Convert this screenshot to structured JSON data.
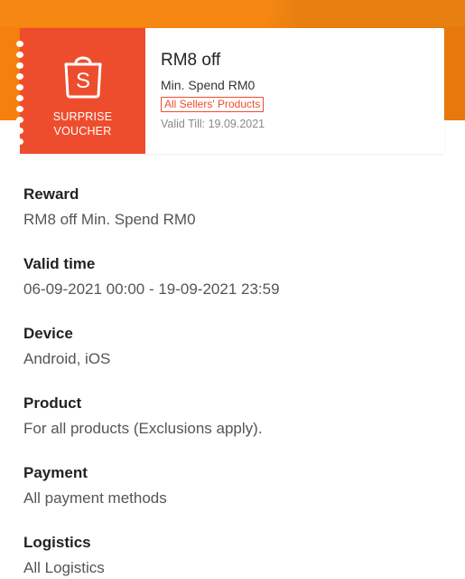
{
  "voucher": {
    "icon": "shopee-bag-icon",
    "icon_letter": "S",
    "tag_line1": "SURPRISE",
    "tag_line2": "VOUCHER",
    "title": "RM8 off",
    "min_spend": "Min. Spend RM0",
    "chip": "All Sellers' Products",
    "valid_till": "Valid Till: 19.09.2021",
    "colors": {
      "brand": "#ee4d2d",
      "header": "#f5800d"
    }
  },
  "details": [
    {
      "label": "Reward",
      "value": "RM8 off Min. Spend RM0"
    },
    {
      "label": "Valid time",
      "value": "06-09-2021 00:00 - 19-09-2021 23:59"
    },
    {
      "label": "Device",
      "value": "Android, iOS"
    },
    {
      "label": "Product",
      "value": "For all products (Exclusions apply)."
    },
    {
      "label": "Payment",
      "value": "All payment methods"
    },
    {
      "label": "Logistics",
      "value": "All Logistics"
    }
  ]
}
